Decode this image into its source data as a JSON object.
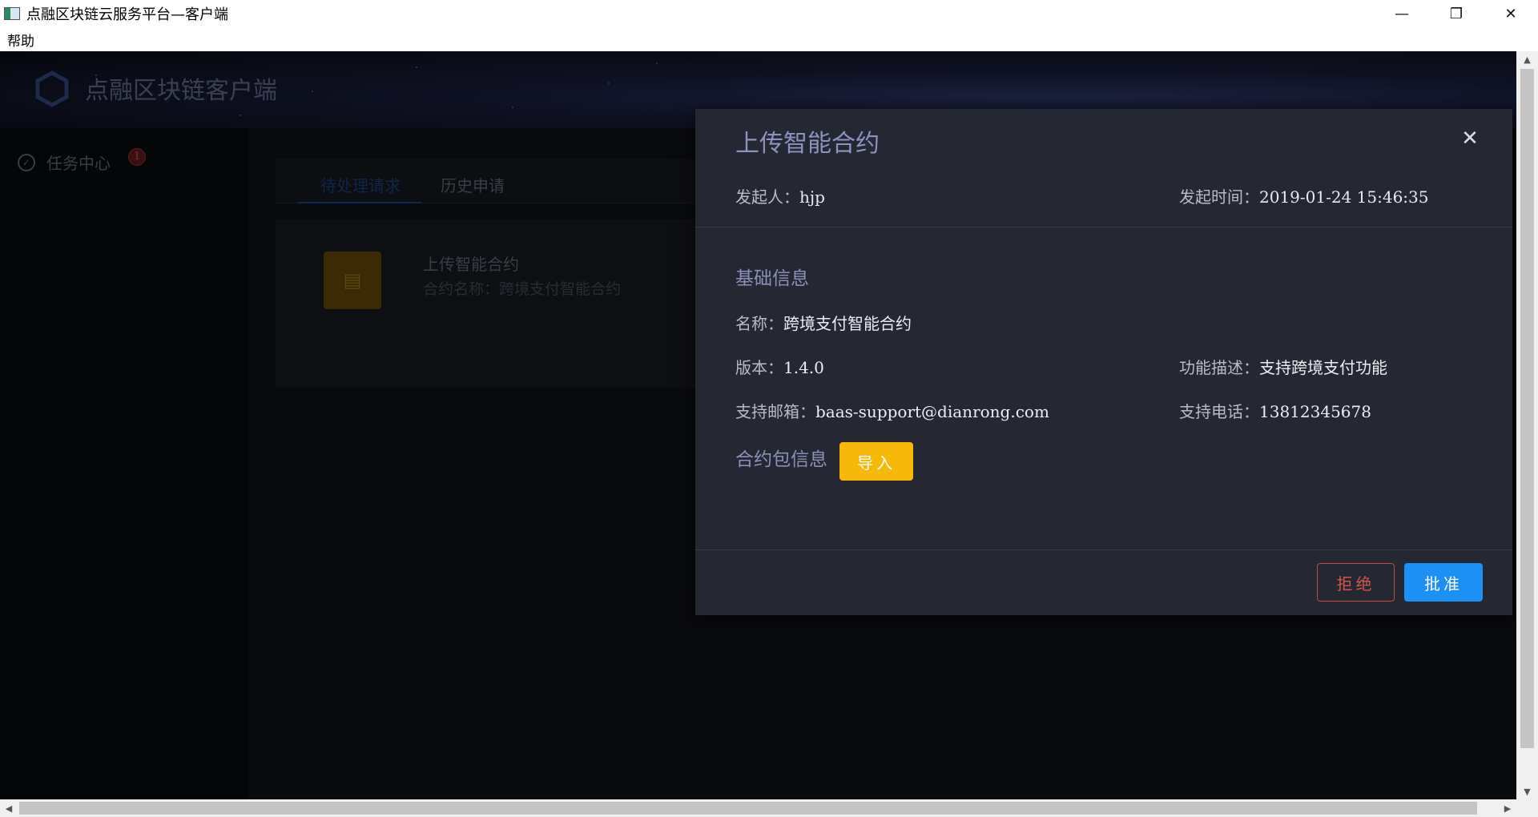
{
  "window": {
    "title": "点融区块链云服务平台—客户端",
    "minimize_glyph": "—",
    "restore_glyph": "❐",
    "close_glyph": "✕"
  },
  "menubar": {
    "help": "帮助"
  },
  "app": {
    "name": "点融区块链客户端",
    "sidebar": {
      "task_center": "任务中心",
      "badge_count": "1"
    },
    "tabs": [
      {
        "label": "待处理请求",
        "active": true
      },
      {
        "label": "历史申请",
        "active": false
      }
    ],
    "task_card": {
      "title": "上传智能合约",
      "subtitle": "合约名称：跨境支付智能合约",
      "icon": "document-icon"
    }
  },
  "modal": {
    "title": "上传智能合约",
    "close_glyph": "✕",
    "initiator_label": "发起人：",
    "initiator_value": "hjp",
    "time_label": "发起时间：",
    "time_value": "2019-01-24 15:46:35",
    "basic_info_title": "基础信息",
    "name_label": "名称：",
    "name_value": "跨境支付智能合约",
    "version_label": "版本：",
    "version_value": "1.4.0",
    "desc_label": "功能描述：",
    "desc_value": "支持跨境支付功能",
    "email_label": "支持邮箱：",
    "email_value": "baas-support@dianrong.com",
    "phone_label": "支持电话：",
    "phone_value": "13812345678",
    "package_title": "合约包信息",
    "import_label": "导入",
    "reject_label": "拒绝",
    "approve_label": "批准"
  },
  "colors": {
    "modal_bg": "#252732",
    "accent_blue": "#1c90f4",
    "import_yellow": "#f6b90a",
    "reject_red": "#d1564a",
    "section_title": "#8a90b8"
  }
}
